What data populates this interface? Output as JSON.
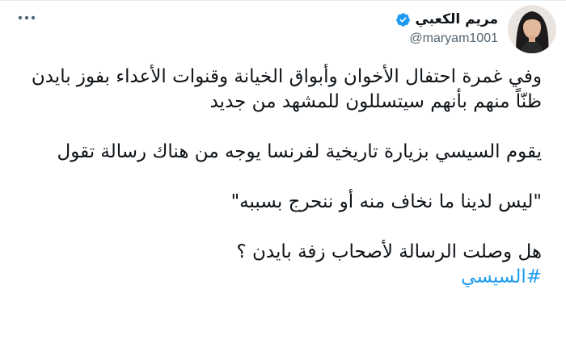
{
  "tweet": {
    "author": {
      "display_name": "مريم الكعبي",
      "handle": "@maryam1001",
      "verified": true
    },
    "body": {
      "paragraph_1": "وفي غمرة احتفال الأخوان وأبواق الخيانة وقنوات الأعداء بفوز بايدن ظنّاً منهم بأنهم سيتسللون للمشهد من جديد",
      "paragraph_2": "يقوم السيسي بزيارة تاريخية لفرنسا يوجه من هناك رسالة تقول",
      "paragraph_3": "\"ليس لدينا ما نخاف منه أو ننحرج بسببه\"",
      "paragraph_4": "هل وصلت الرسالة لأصحاب زفة بايدن ؟",
      "hashtag": "#السيسي"
    }
  },
  "colors": {
    "link": "#1d9bf0",
    "text": "#0f1419",
    "secondary_text": "#536471",
    "verified_badge": "#1d9bf0"
  },
  "icons": {
    "more": "more-horizontal-icon",
    "verified": "verified-badge-icon"
  }
}
